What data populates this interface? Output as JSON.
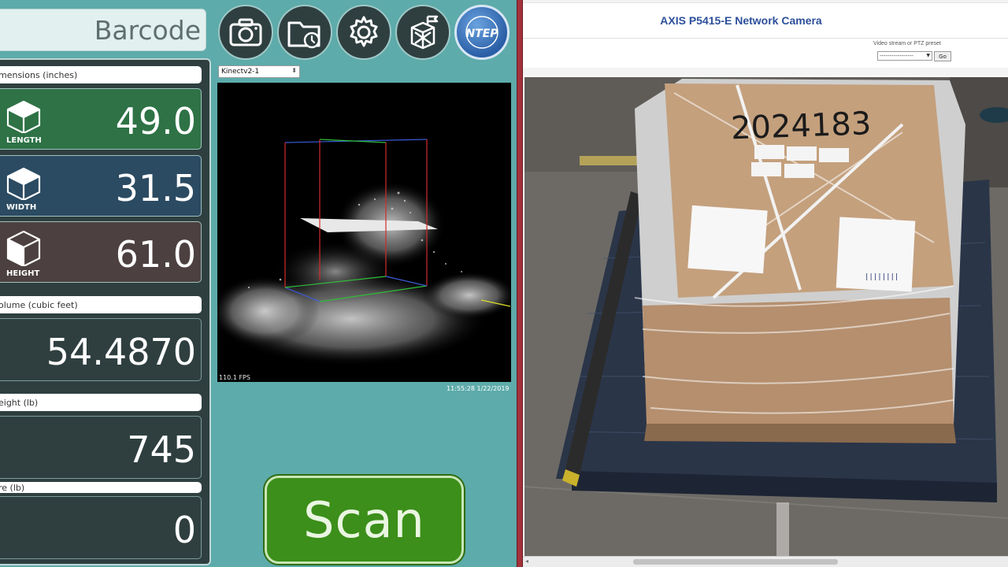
{
  "app": {
    "barcode_text": "Barcode",
    "toolbar": {
      "camera_icon": "camera-icon",
      "folder_icon": "folder-history-icon",
      "settings_icon": "gear-icon",
      "package_icon": "package-cancel-icon",
      "ntep_logo_text": "NTEP"
    },
    "dimensions_label": "mensions (inches)",
    "length": {
      "label": "LENGTH",
      "value": "49.0",
      "color": "#2e7245"
    },
    "width": {
      "label": "WIDTH",
      "value": "31.5",
      "color": "#2b4b62"
    },
    "height": {
      "label": "HEIGHT",
      "value": "61.0",
      "color": "#4c4140"
    },
    "volume": {
      "label": "olume (cubic feet)",
      "value": "54.4870"
    },
    "weight": {
      "label": "eight (lb)",
      "value": "745"
    },
    "tare": {
      "label": "re (lb)",
      "value": "0"
    },
    "sensor_select": {
      "value": "Kinectv2-1"
    },
    "viewport": {
      "fps": "110.1 FPS",
      "timestamp": "11:55:28 1/22/2019"
    },
    "scan_label": "Scan",
    "accent_green": "#3c8f1a",
    "background_teal": "#5dabaa"
  },
  "camera_page": {
    "title": "AXIS P5415-E Network Camera",
    "stream_label": "Video stream or PTZ preset",
    "stream_select_value": "-----------------",
    "go_label": "Go",
    "pallet_number": "2024183",
    "label_code": "||||||||"
  }
}
